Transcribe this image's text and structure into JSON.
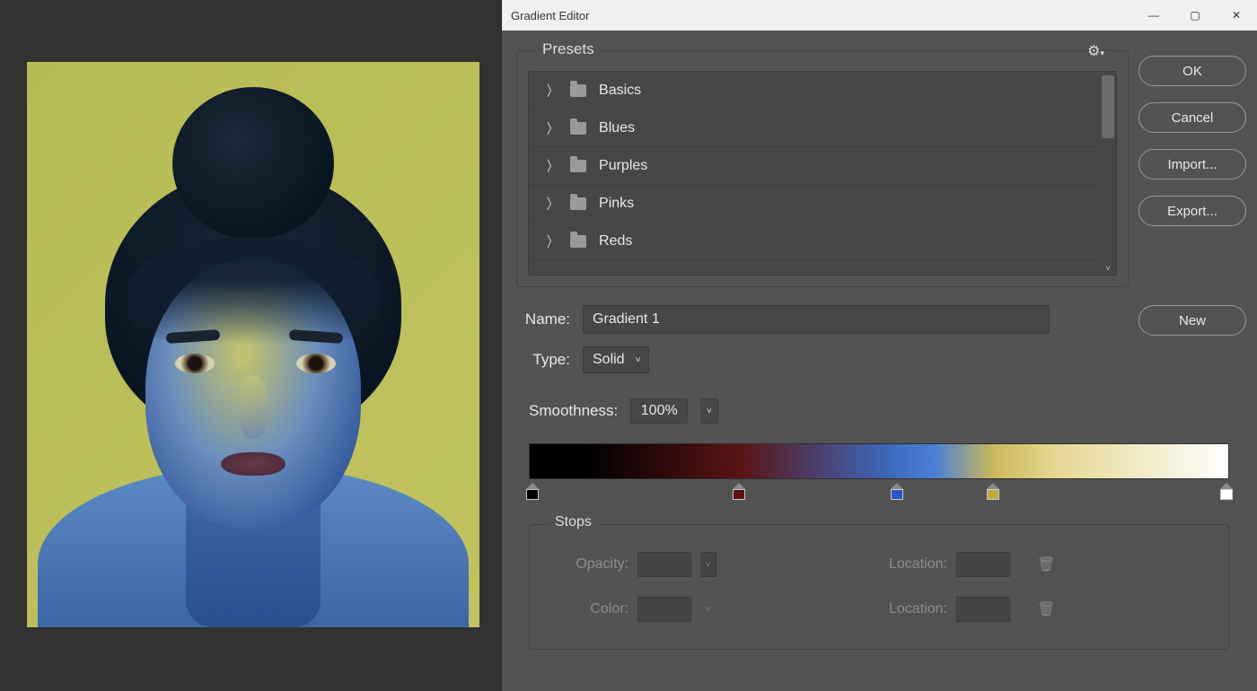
{
  "canvas": {
    "alt": "Duotone portrait preview"
  },
  "dialog": {
    "title": "Gradient Editor",
    "window_buttons": {
      "min": "—",
      "max": "▢",
      "close": "✕"
    },
    "actions": {
      "ok": "OK",
      "cancel": "Cancel",
      "import": "Import...",
      "export": "Export...",
      "new": "New"
    },
    "presets": {
      "legend": "Presets",
      "gear_icon": "gear",
      "items": [
        {
          "label": "Basics"
        },
        {
          "label": "Blues"
        },
        {
          "label": "Purples"
        },
        {
          "label": "Pinks"
        },
        {
          "label": "Reds"
        }
      ]
    },
    "name": {
      "label": "Name:",
      "value": "Gradient 1"
    },
    "type": {
      "label": "Type:",
      "value": "Solid"
    },
    "smoothness": {
      "label": "Smoothness:",
      "value": "100%"
    },
    "gradient": {
      "stops": [
        {
          "pos_pct": 0.5,
          "color": "#000000"
        },
        {
          "pos_pct": 30.0,
          "color": "#5a1414"
        },
        {
          "pos_pct": 52.5,
          "color": "#2a56c4"
        },
        {
          "pos_pct": 66.3,
          "color": "#bfa93e"
        },
        {
          "pos_pct": 99.6,
          "color": "#ffffff"
        }
      ]
    },
    "stops_panel": {
      "legend": "Stops",
      "opacity_label": "Opacity:",
      "color_label": "Color:",
      "location_label": "Location:",
      "opacity_value": "",
      "color_value": "",
      "location1_value": "",
      "location2_value": ""
    }
  }
}
